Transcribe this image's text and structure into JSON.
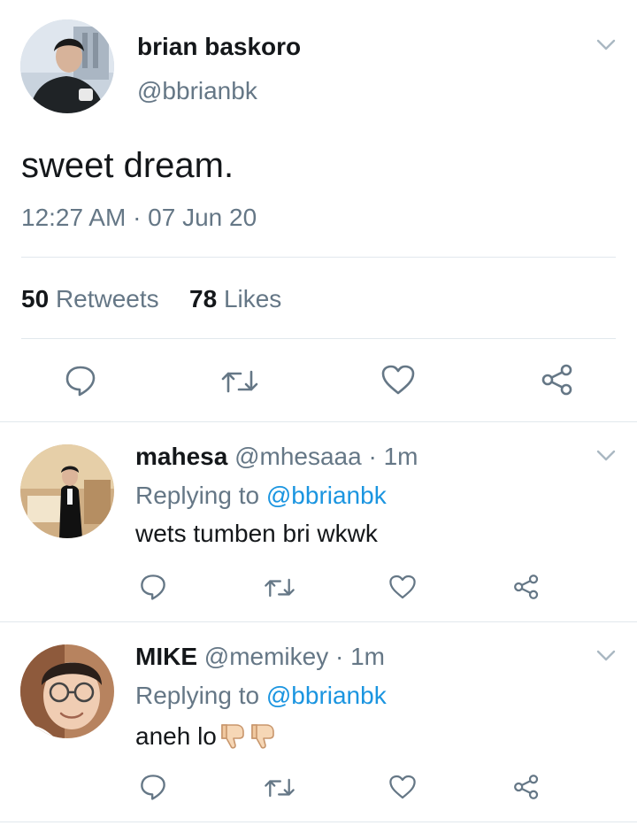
{
  "main_tweet": {
    "display_name": "brian baskoro",
    "handle": "@bbrianbk",
    "text": "sweet dream.",
    "timestamp": "12:27 AM · 07 Jun 20",
    "retweet_count": "50",
    "retweet_label": "Retweets",
    "like_count": "78",
    "like_label": "Likes"
  },
  "replies": [
    {
      "display_name": "mahesa",
      "handle": "@mhesaaa",
      "time": "· 1m",
      "replying_prefix": "Replying to",
      "replying_to": "@bbrianbk",
      "text": "wets tumben bri wkwk"
    },
    {
      "display_name": "MIKE",
      "handle": "@memikey",
      "time": "· 1m",
      "replying_prefix": "Replying to",
      "replying_to": "@bbrianbk",
      "text": "aneh lo"
    }
  ],
  "icons": {
    "reply": "reply-icon",
    "retweet": "retweet-icon",
    "like": "heart-icon",
    "share": "share-icon",
    "menu": "chevron-down-icon",
    "emoji": "thumbs-down-icon"
  },
  "colors": {
    "text": "#14171a",
    "muted": "#657786",
    "link": "#1b95e0",
    "divider": "#e1e8ed",
    "icon": "#657786"
  }
}
